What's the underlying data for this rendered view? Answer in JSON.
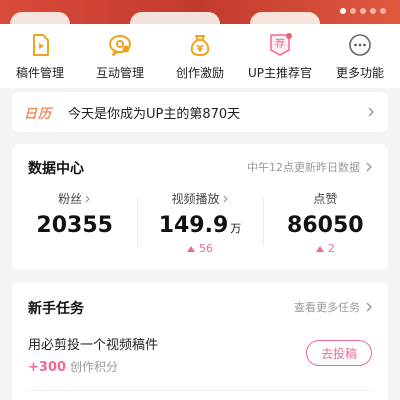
{
  "quick_actions": [
    {
      "label": "稿件管理",
      "icon": "manuscript-icon"
    },
    {
      "label": "互动管理",
      "icon": "interaction-icon"
    },
    {
      "label": "创作激励",
      "icon": "money-bag-icon"
    },
    {
      "label": "UP主推荐官",
      "icon": "recommend-badge-icon"
    },
    {
      "label": "更多功能",
      "icon": "more-icon"
    }
  ],
  "calendar": {
    "tag": "日历",
    "text": "今天是你成为UP主的第870天"
  },
  "data_center": {
    "title": "数据中心",
    "update_note": "中午12点更新昨日数据",
    "stats": [
      {
        "label": "粉丝",
        "value": "20355",
        "unit": "",
        "delta": ""
      },
      {
        "label": "视频播放",
        "value": "149.9",
        "unit": "万",
        "delta": "56"
      },
      {
        "label": "点赞",
        "value": "86050",
        "unit": "",
        "delta": "2"
      }
    ]
  },
  "tasks": {
    "title": "新手任务",
    "more": "查看更多任务",
    "item_title": "用必剪投一个视频稿件",
    "reward_points": "+300",
    "reward_label": "创作积分",
    "button": "去投稿"
  },
  "colors": {
    "accent": "#f0679a",
    "tag_orange": "#f08c5a",
    "icon_orange": "#f2a31e",
    "banner_red": "#d94a3a"
  }
}
